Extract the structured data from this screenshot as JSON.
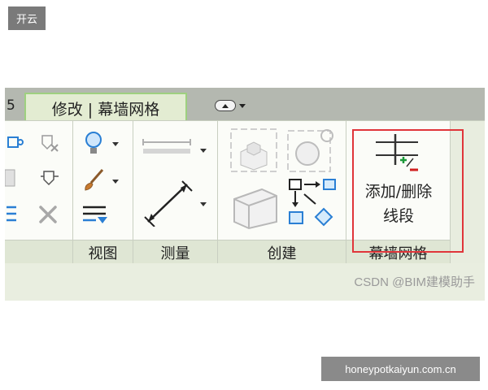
{
  "corner_badge": "开云",
  "watermark_url": "honeypotkaiyun.com.cn",
  "csdn_watermark": "CSDN @BIM建模助手",
  "tabs": {
    "partial": "5",
    "active": "修改 | 幕墙网格"
  },
  "panels": {
    "view": {
      "label": "视图"
    },
    "measure": {
      "label": "测量"
    },
    "create": {
      "label": "创建"
    },
    "curtain_grid": {
      "label": "幕墙网格",
      "button_line1": "添加/删除",
      "button_line2": "线段"
    }
  },
  "colors": {
    "tab_active_bg": "#e3ecd2",
    "ribbon_body_bg": "#fbfcf8",
    "panel_label_bg": "#dfe6d4",
    "highlight_border": "#e0353a",
    "accent_blue": "#2a7fd4"
  }
}
